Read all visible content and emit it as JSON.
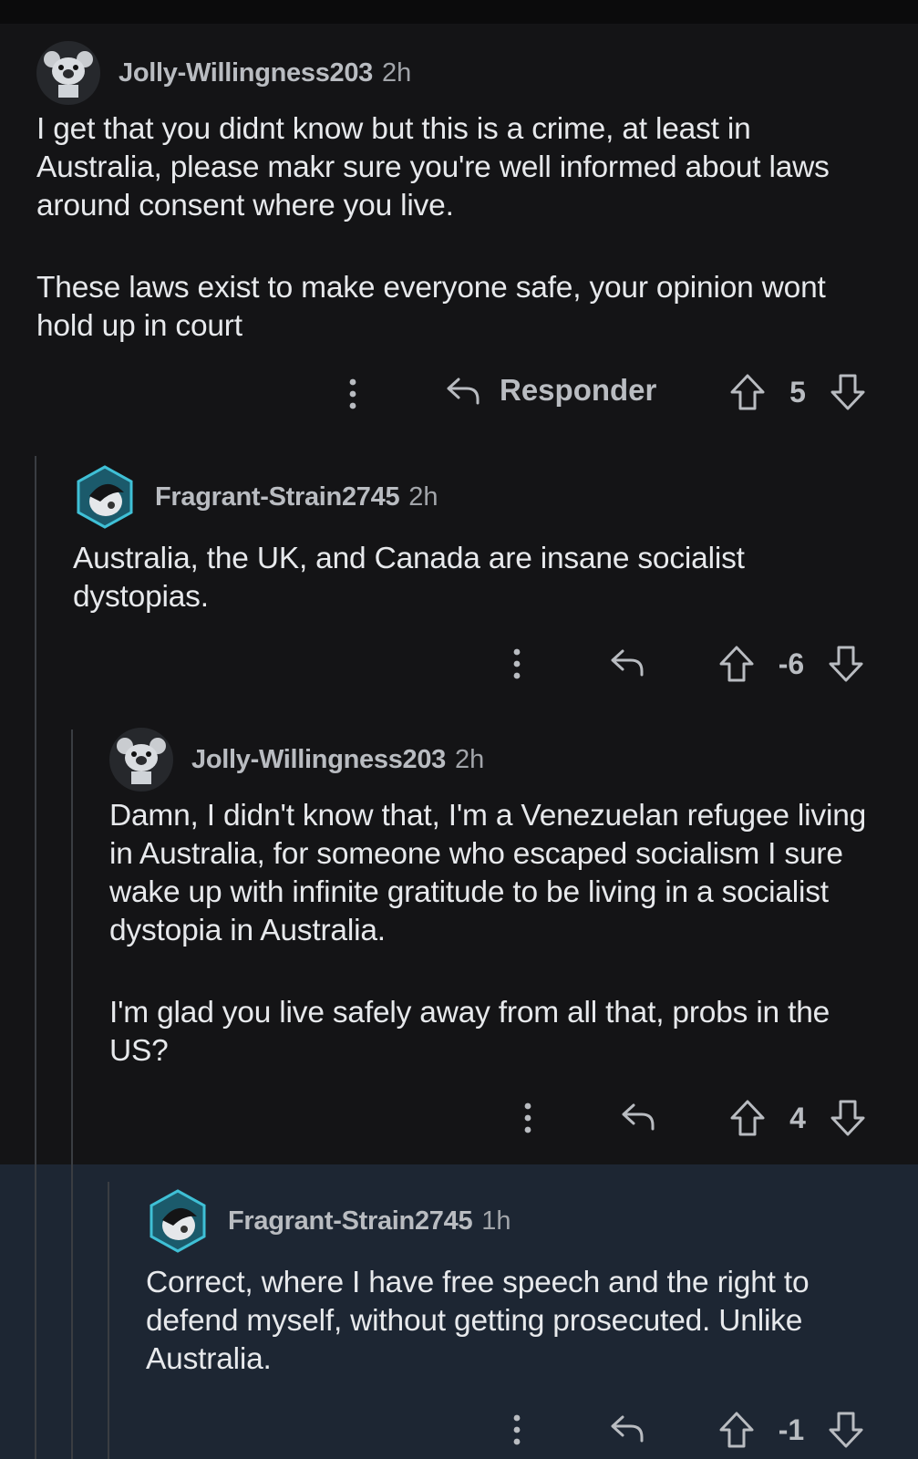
{
  "comments": [
    {
      "author": "Jolly-Willingness203",
      "time": "2h",
      "avatar": "snoo-koala-avatar",
      "paragraphs": [
        "I get that you didnt know but this is a crime, at least in Australia, please makr sure you're well informed about laws around consent where you live.",
        "These laws exist to make everyone safe, your opinion wont hold up in court"
      ],
      "reply_label": "Responder",
      "score": "5"
    },
    {
      "author": "Fragrant-Strain2745",
      "time": "2h",
      "avatar": "snoo-hex-avatar",
      "paragraphs": [
        "Australia, the UK, and Canada are insane socialist dystopias."
      ],
      "reply_label": "",
      "score": "-6"
    },
    {
      "author": "Jolly-Willingness203",
      "time": "2h",
      "avatar": "snoo-koala-avatar",
      "paragraphs": [
        "Damn, I didn't know that, I'm a Venezuelan refugee living in Australia, for someone who escaped socialism I sure wake up with infinite gratitude to be living in a socialist dystopia in Australia.",
        "I'm glad you live safely away from all that, probs in the US?"
      ],
      "reply_label": "",
      "score": "4"
    },
    {
      "author": "Fragrant-Strain2745",
      "time": "1h",
      "avatar": "snoo-hex-avatar",
      "paragraphs": [
        "Correct, where I have free speech and the right to defend myself, without getting prosecuted. Unlike Australia."
      ],
      "reply_label": "",
      "score": "-1"
    }
  ],
  "icons": {
    "more": "more-vertical-icon",
    "reply": "reply-arrow-icon",
    "upvote": "upvote-arrow-icon",
    "downvote": "downvote-arrow-icon"
  },
  "colors": {
    "background": "#141416",
    "highlight": "#1d2633",
    "text": "#e7e9ec",
    "muted": "#b9bcc1",
    "thread_line": "#3a3d42"
  }
}
